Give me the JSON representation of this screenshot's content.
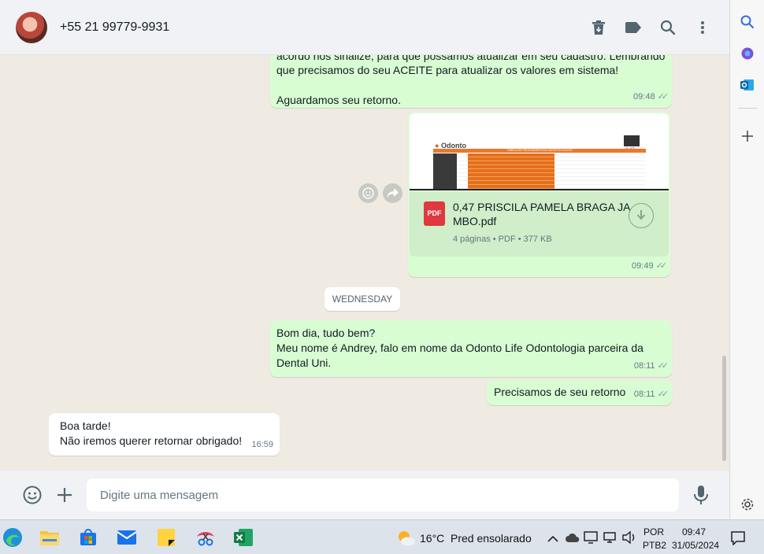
{
  "header": {
    "contact_name": "+55 21 99779-9931"
  },
  "messages": {
    "msg1": {
      "line1": "acordo nos sinalize, para que possamos atualizar em seu cadastro. Lembrando",
      "line2": "que precisamos do seu ACEITE para atualizar os valores em sistema!",
      "line3": "Aguardamos seu retorno.",
      "time": "09:48"
    },
    "doc": {
      "preview_brand": "Odonto",
      "preview_value": "0,47",
      "preview_table_title": "TABELA DE PROCEDIMENTOS ODONTOLÓGICOS",
      "file_type": "PDF",
      "file_name_line1": "0,47 PRISCILA PAMELA BRAGA JA",
      "file_name_line2": "MBO.pdf",
      "file_meta": "4 páginas • PDF • 377 KB",
      "time": "09:49"
    },
    "day_separator": "WEDNESDAY",
    "msg2": {
      "line1": "Bom dia, tudo bem?",
      "line2": "Meu nome é Andrey, falo em nome da Odonto Life Odontologia parceira da",
      "line3": "Dental Uni.",
      "time": "08:11"
    },
    "msg3": {
      "text": "Precisamos de seu retorno",
      "time": "08:11"
    },
    "msg4": {
      "line1": "Boa tarde!",
      "line2": "Não iremos querer retornar obrigado!",
      "time": "16:59"
    }
  },
  "composer": {
    "placeholder": "Digite uma mensagem"
  },
  "taskbar": {
    "weather_temp": "16°C",
    "weather_text": "Pred ensolarado",
    "lang_line1": "POR",
    "lang_line2": "PTB2",
    "clock_time": "09:47",
    "clock_date": "31/05/2024"
  },
  "colors": {
    "outgoing_bubble": "#d9fdd3",
    "incoming_bubble": "#ffffff",
    "chat_background": "#efeae2",
    "header_background": "#f0f2f5",
    "pdf_red": "#e0383e"
  }
}
